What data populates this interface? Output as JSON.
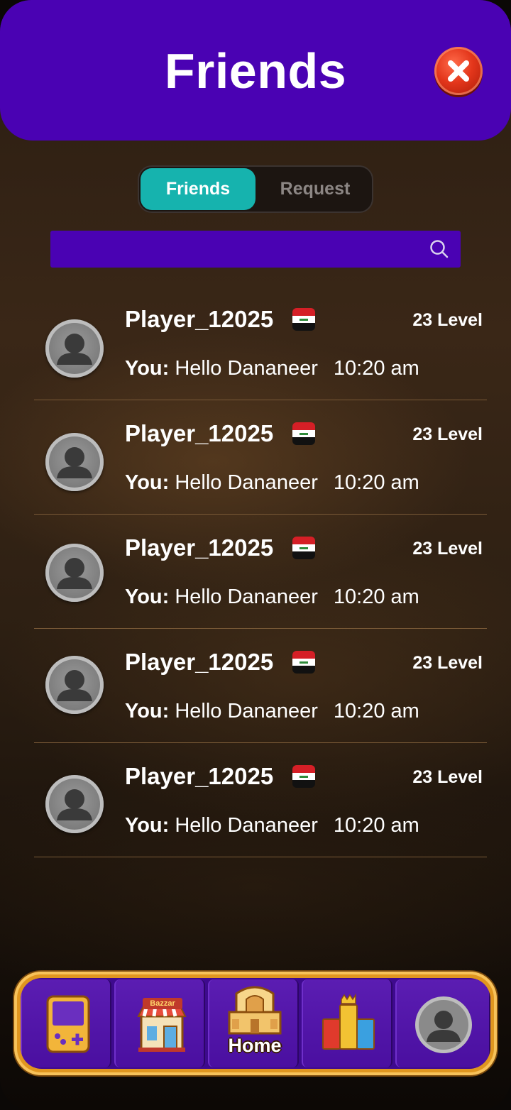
{
  "header": {
    "title": "Friends",
    "close_icon": "close-x-icon"
  },
  "tabs": [
    {
      "label": "Friends",
      "active": true
    },
    {
      "label": "Request",
      "active": false
    }
  ],
  "search": {
    "placeholder": "",
    "value": "",
    "icon": "search-icon"
  },
  "friends": [
    {
      "name": "Player_12025",
      "flag": "iraq-flag",
      "level": "23 Level",
      "sender": "You:",
      "message": "Hello Dananeer",
      "time": "10:20 am"
    },
    {
      "name": "Player_12025",
      "flag": "iraq-flag",
      "level": "23 Level",
      "sender": "You:",
      "message": "Hello Dananeer",
      "time": "10:20 am"
    },
    {
      "name": "Player_12025",
      "flag": "iraq-flag",
      "level": "23 Level",
      "sender": "You:",
      "message": "Hello Dananeer",
      "time": "10:20 am"
    },
    {
      "name": "Player_12025",
      "flag": "iraq-flag",
      "level": "23 Level",
      "sender": "You:",
      "message": "Hello Dananeer",
      "time": "10:20 am"
    },
    {
      "name": "Player_12025",
      "flag": "iraq-flag",
      "level": "23 Level",
      "sender": "You:",
      "message": "Hello Dananeer",
      "time": "10:20 am"
    }
  ],
  "nav": {
    "items": [
      {
        "icon": "game-console-icon",
        "label": ""
      },
      {
        "icon": "bazaar-shop-icon",
        "sign": "Bazzar"
      },
      {
        "icon": "home-building-icon",
        "label": "Home"
      },
      {
        "icon": "leaderboard-podium-icon",
        "label": ""
      },
      {
        "icon": "profile-avatar-icon",
        "label": ""
      }
    ]
  },
  "colors": {
    "header_bg": "#4a02b3",
    "tab_active": "#16b3ae",
    "nav_frame": "#e0961f",
    "divider": "#7a5a37"
  }
}
